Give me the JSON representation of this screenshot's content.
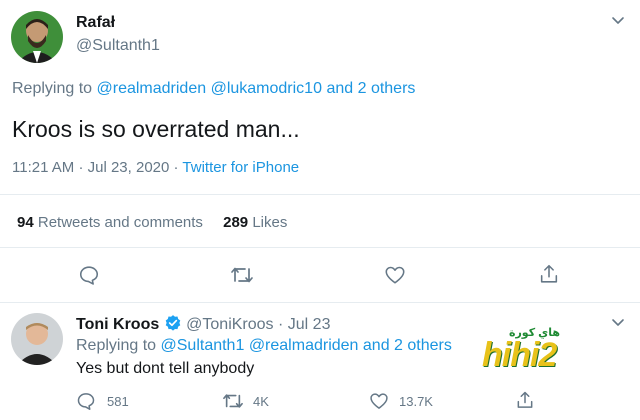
{
  "tweet": {
    "author_name": "Rafał",
    "author_handle": "@Sultanth1",
    "replying_prefix": "Replying to",
    "replying_to_1": "@realmadriden",
    "replying_to_2": "@lukamodric10",
    "replying_and": "and",
    "replying_others": "2 others",
    "text": "Kroos is so overrated man...",
    "time": "11:21 AM",
    "date": "Jul 23, 2020",
    "separator": "·",
    "source": "Twitter for iPhone",
    "retweets_count": "94",
    "retweets_label": "Retweets and comments",
    "likes_count": "289",
    "likes_label": "Likes"
  },
  "reply": {
    "author_name": "Toni Kroos",
    "author_handle": "@ToniKroos",
    "separator": "·",
    "date": "Jul 23",
    "replying_prefix": "Replying to",
    "replying_to_1": "@Sultanth1",
    "replying_to_2": "@realmadriden",
    "replying_and": "and",
    "replying_others": "2 others",
    "text": "Yes but dont tell anybody",
    "reply_count": "581",
    "retweet_count": "4K",
    "like_count": "13.7K"
  },
  "watermark": {
    "text": "hihi2",
    "arabic_text": "هاي كورة"
  },
  "colors": {
    "link": "#1b95e0",
    "secondary": "#657786",
    "verified": "#1da1f2",
    "divider": "#e6ecf0"
  },
  "icons": {
    "reply": "comment-icon",
    "retweet": "retweet-icon",
    "like": "heart-icon",
    "share": "share-icon",
    "menu": "chevron-down-icon",
    "verified": "verified-badge-icon"
  }
}
